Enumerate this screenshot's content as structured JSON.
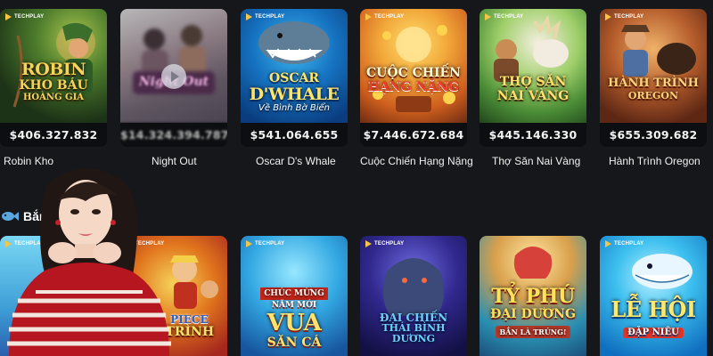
{
  "provider_badge": "TECHPLAY",
  "top_games": [
    {
      "name": "Robin Kho",
      "jackpot": "$406.327.832",
      "logo": [
        "ROBIN",
        "KHO BÁU",
        "HOÀNG GIA"
      ]
    },
    {
      "name": "Night Out",
      "jackpot": "$14.324.394.787",
      "logo": [
        "Night Out"
      ]
    },
    {
      "name": "Oscar D's Whale",
      "jackpot": "$541.064.655",
      "logo": [
        "OSCAR",
        "D'WHALE",
        "Về Bình Bờ Biển"
      ]
    },
    {
      "name": "Cuộc Chiến Hạng Nặng",
      "jackpot": "$7.446.672.684",
      "logo": [
        "CUỘC CHIẾN",
        "HẠNG NẶNG"
      ]
    },
    {
      "name": "Thợ Săn Nai Vàng",
      "jackpot": "$445.146.330",
      "logo": [
        "THỢ SĂN",
        "NAI VÀNG"
      ]
    },
    {
      "name": "Hành Trình Oregon",
      "jackpot": "$655.309.682",
      "logo": [
        "HÀNH TRÌNH",
        "OREGON"
      ]
    }
  ],
  "section": {
    "title": "Bắn",
    "icon": "fish-icon"
  },
  "fish_games": [
    {
      "logo": []
    },
    {
      "logo": [
        "ONE PIECE",
        "HÀI TRÌNH"
      ]
    },
    {
      "logo": [
        "CHÚC MỪNG",
        "NĂM MỚI",
        "VUA",
        "SĂN CÁ"
      ]
    },
    {
      "logo": [
        "ĐẠI CHIẾN",
        "THÁI BÌNH DƯƠNG"
      ]
    },
    {
      "logo": [
        "TỶ PHÚ",
        "ĐẠI DƯƠNG",
        "BẮN LÀ TRÚNG!"
      ]
    },
    {
      "logo": [
        "LỄ HỘI",
        "ĐẶP NIÊU"
      ]
    }
  ]
}
